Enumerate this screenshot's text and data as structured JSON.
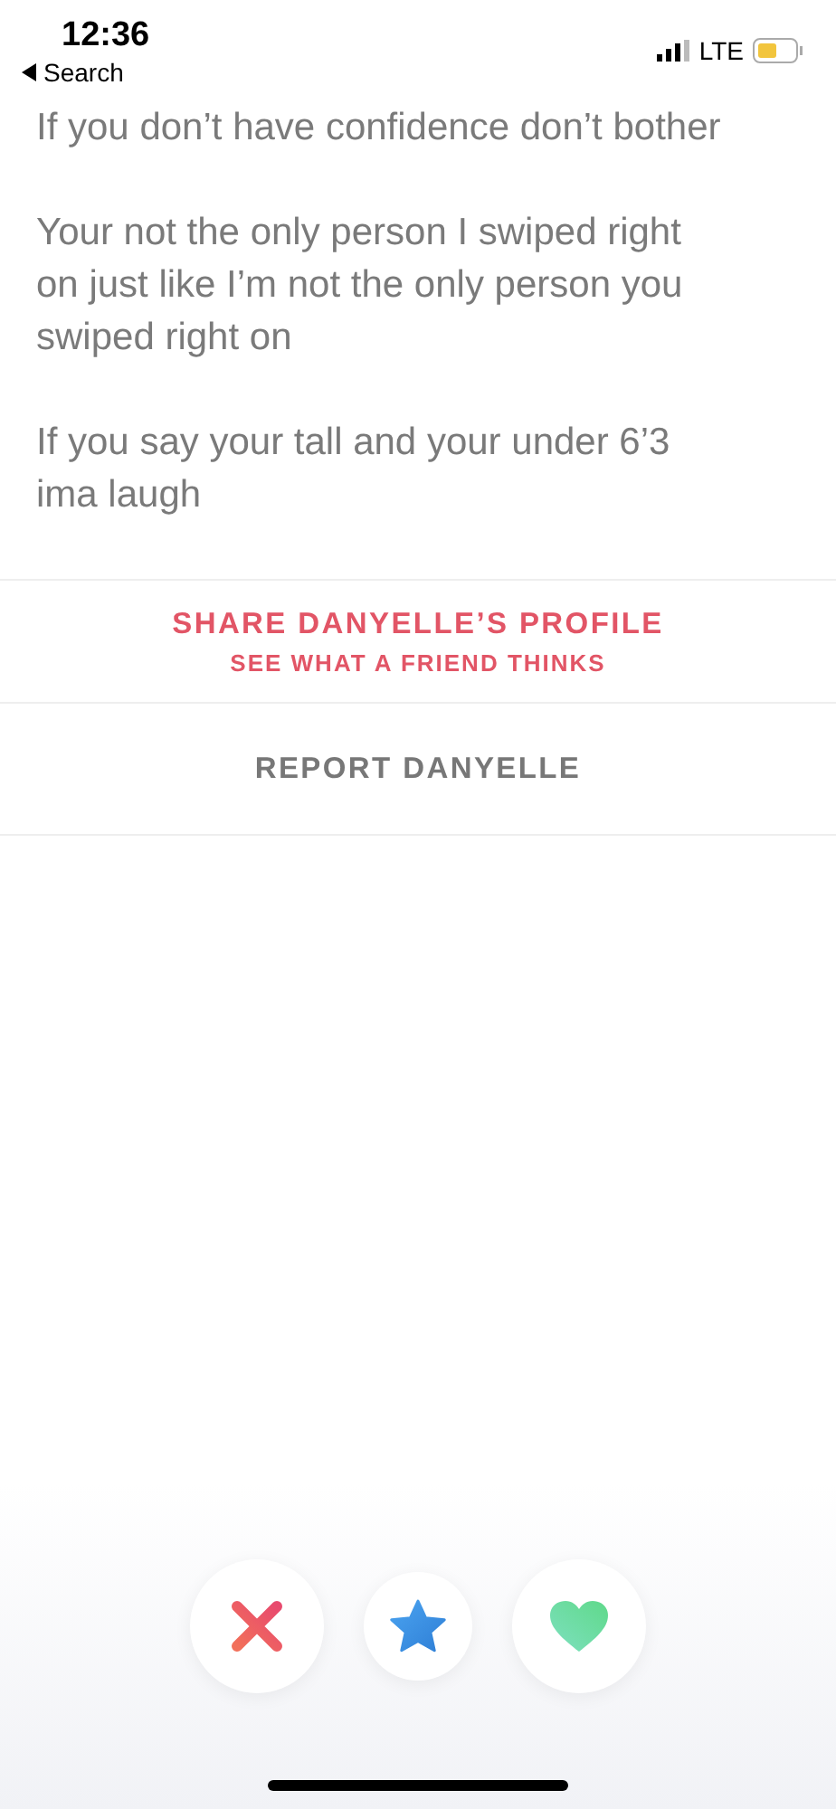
{
  "status_bar": {
    "time": "12:36",
    "back_label": "Search",
    "network": "LTE"
  },
  "bio": [
    "If you don’t have confidence don’t bother",
    "Your not the only person I swiped right on just like I’m not the only person you swiped right on",
    "If you say your tall and your under 6’3 ima laugh"
  ],
  "share": {
    "title": "SHARE DANYELLE’S PROFILE",
    "subtitle": "SEE WHAT A FRIEND THINKS"
  },
  "report": "REPORT DANYELLE",
  "actions": [
    {
      "kind": "nope"
    },
    {
      "kind": "super_like"
    },
    {
      "kind": "like"
    }
  ]
}
